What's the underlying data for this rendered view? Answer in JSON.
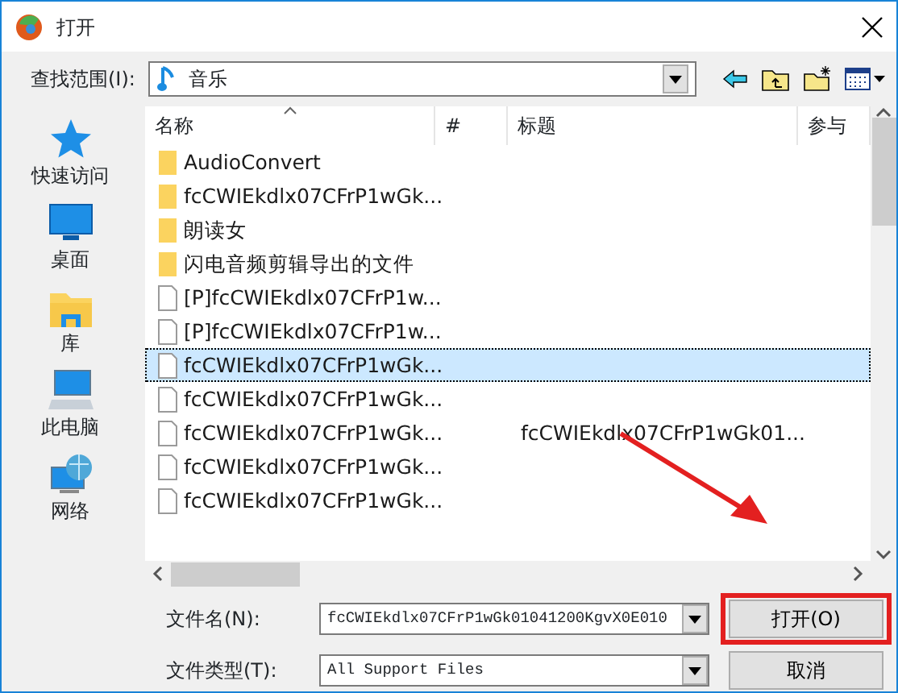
{
  "window": {
    "title": "打开"
  },
  "look_in": {
    "label": "查找范围(I):",
    "value": "音乐"
  },
  "sidebar": {
    "items": [
      {
        "label": "快速访问",
        "kind": "star"
      },
      {
        "label": "桌面",
        "kind": "desktop"
      },
      {
        "label": "库",
        "kind": "library"
      },
      {
        "label": "此电脑",
        "kind": "computer"
      },
      {
        "label": "网络",
        "kind": "network"
      }
    ]
  },
  "file_list": {
    "columns": [
      "名称",
      "#",
      "标题",
      "参与"
    ],
    "rows": [
      {
        "name": "AudioConvert",
        "kind": "folder",
        "selected": false
      },
      {
        "name": "fcCWIEkdlx07CFrP1wGk...",
        "kind": "folder",
        "selected": false
      },
      {
        "name": "朗读女",
        "kind": "folder",
        "selected": false
      },
      {
        "name": "闪电音频剪辑导出的文件",
        "kind": "folder",
        "selected": false
      },
      {
        "name": "[P]fcCWIEkdlx07CFrP1w...",
        "kind": "file",
        "selected": false
      },
      {
        "name": "[P]fcCWIEkdlx07CFrP1w...",
        "kind": "file",
        "selected": false
      },
      {
        "name": "fcCWIEkdlx07CFrP1wGk...",
        "kind": "file",
        "selected": true
      },
      {
        "name": "fcCWIEkdlx07CFrP1wGk...",
        "kind": "file",
        "selected": false
      },
      {
        "name": "fcCWIEkdlx07CFrP1wGk...",
        "kind": "file",
        "selected": false,
        "title": "fcCWIEkdlx07CFrP1wGk01..."
      },
      {
        "name": "fcCWIEkdlx07CFrP1wGk...",
        "kind": "file",
        "selected": false
      },
      {
        "name": "fcCWIEkdlx07CFrP1wGk...",
        "kind": "file",
        "selected": false
      }
    ]
  },
  "file_name": {
    "label": "文件名(N):",
    "value": "fcCWIEkdlx07CFrP1wGk01041200KgvX0E010"
  },
  "file_type": {
    "label": "文件类型(T):",
    "value": "All Support Files"
  },
  "buttons": [
    {
      "label": "打开(O)",
      "highlighted": true
    },
    {
      "label": "取消",
      "highlighted": false
    }
  ]
}
